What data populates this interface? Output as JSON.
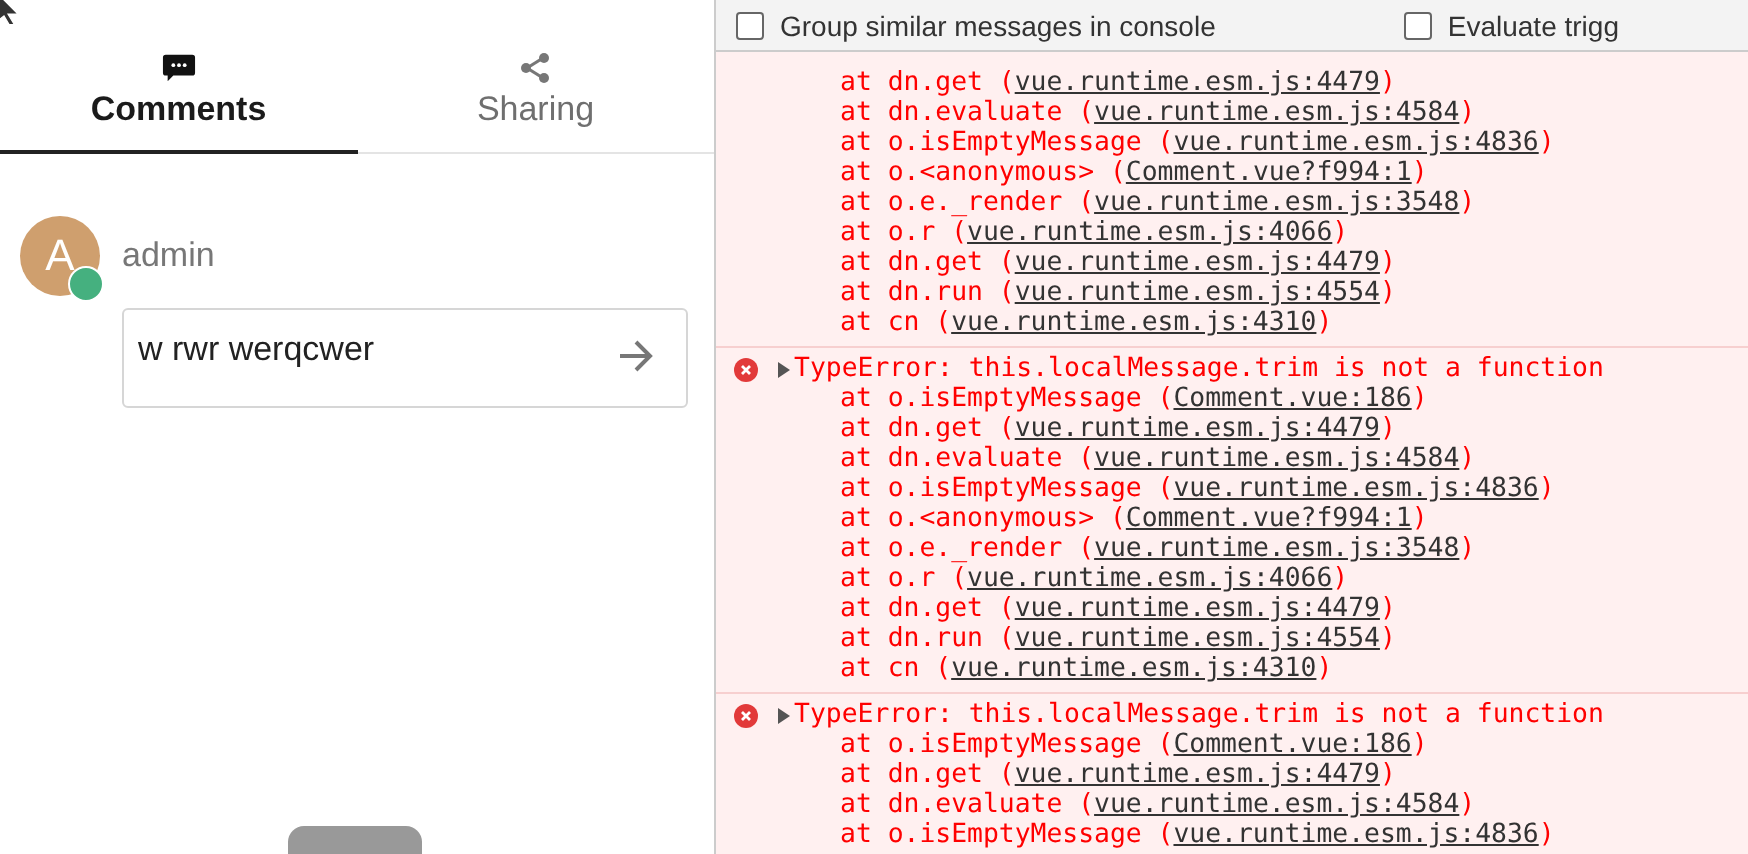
{
  "tabs": [
    {
      "label": "Comments",
      "kind": "comment",
      "selected": true
    },
    {
      "label": "Sharing",
      "kind": "share",
      "selected": false
    }
  ],
  "composer": {
    "avatar_letter": "A",
    "online": true,
    "author": "admin",
    "value": "w rwr werqcwer"
  },
  "console": {
    "options": [
      {
        "label": "Group similar messages in console",
        "checked": false
      },
      {
        "label": "Evaluate trigg",
        "checked": false
      }
    ],
    "entries": [
      {
        "kind": "continuation",
        "frames": [
          {
            "call": "at dn.get (",
            "source": "vue.runtime.esm.js:4479",
            "close": ")"
          },
          {
            "call": "at dn.evaluate (",
            "source": "vue.runtime.esm.js:4584",
            "close": ")"
          },
          {
            "call": "at o.isEmptyMessage (",
            "source": "vue.runtime.esm.js:4836",
            "close": ")"
          },
          {
            "call": "at o.<anonymous> (",
            "source": "Comment.vue?f994:1",
            "close": ")"
          },
          {
            "call": "at o.e._render (",
            "source": "vue.runtime.esm.js:3548",
            "close": ")"
          },
          {
            "call": "at o.r (",
            "source": "vue.runtime.esm.js:4066",
            "close": ")"
          },
          {
            "call": "at dn.get (",
            "source": "vue.runtime.esm.js:4479",
            "close": ")"
          },
          {
            "call": "at dn.run (",
            "source": "vue.runtime.esm.js:4554",
            "close": ")"
          },
          {
            "call": "at cn (",
            "source": "vue.runtime.esm.js:4310",
            "close": ")"
          }
        ]
      },
      {
        "kind": "error",
        "message": "TypeError: this.localMessage.trim is not a function",
        "expanded": false,
        "frames": [
          {
            "call": "at o.isEmptyMessage (",
            "source": "Comment.vue:186",
            "close": ")"
          },
          {
            "call": "at dn.get (",
            "source": "vue.runtime.esm.js:4479",
            "close": ")"
          },
          {
            "call": "at dn.evaluate (",
            "source": "vue.runtime.esm.js:4584",
            "close": ")"
          },
          {
            "call": "at o.isEmptyMessage (",
            "source": "vue.runtime.esm.js:4836",
            "close": ")"
          },
          {
            "call": "at o.<anonymous> (",
            "source": "Comment.vue?f994:1",
            "close": ")"
          },
          {
            "call": "at o.e._render (",
            "source": "vue.runtime.esm.js:3548",
            "close": ")"
          },
          {
            "call": "at o.r (",
            "source": "vue.runtime.esm.js:4066",
            "close": ")"
          },
          {
            "call": "at dn.get (",
            "source": "vue.runtime.esm.js:4479",
            "close": ")"
          },
          {
            "call": "at dn.run (",
            "source": "vue.runtime.esm.js:4554",
            "close": ")"
          },
          {
            "call": "at cn (",
            "source": "vue.runtime.esm.js:4310",
            "close": ")"
          }
        ]
      },
      {
        "kind": "error",
        "message": "TypeError: this.localMessage.trim is not a function",
        "expanded": false,
        "frames": [
          {
            "call": "at o.isEmptyMessage (",
            "source": "Comment.vue:186",
            "close": ")"
          },
          {
            "call": "at dn.get (",
            "source": "vue.runtime.esm.js:4479",
            "close": ")"
          },
          {
            "call": "at dn.evaluate (",
            "source": "vue.runtime.esm.js:4584",
            "close": ")"
          },
          {
            "call": "at o.isEmptyMessage (",
            "source": "vue.runtime.esm.js:4836",
            "close": ")"
          }
        ]
      }
    ]
  }
}
